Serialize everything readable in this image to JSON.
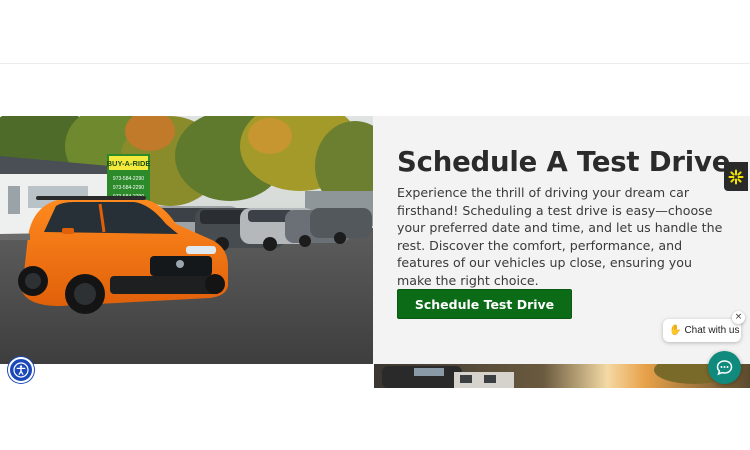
{
  "section": {
    "title": "Schedule A Test Drive",
    "description": "Experience the thrill of driving your dream car firsthand! Scheduling a test drive is easy—choose your preferred date and time, and let us handle the rest. Discover the comfort, performance, and features of our vehicles up close, ensuring you make the right choice.",
    "cta_label": "Schedule Test Drive"
  },
  "dealer_sign": {
    "name": "BUY-A-RIDE",
    "phones": [
      "973-584-2290",
      "973-584-2290",
      "973-584-2290"
    ]
  },
  "chat": {
    "prompt": "Chat with us",
    "close_symbol": "×"
  },
  "icons": {
    "accessibility": "accessibility-icon",
    "side_tab": "sparkle-icon",
    "chat_fab": "chat-icon",
    "wave": "waving-hand-icon"
  },
  "colors": {
    "cta_background": "#0c6b16",
    "title_text": "#2b2b2b",
    "section_background": "#f3f3f3",
    "accessibility_blue": "#1a48b8",
    "chat_teal": "#0f8a7c",
    "side_tab_background": "#2a2a2a",
    "side_tab_icon": "#f2e600"
  }
}
